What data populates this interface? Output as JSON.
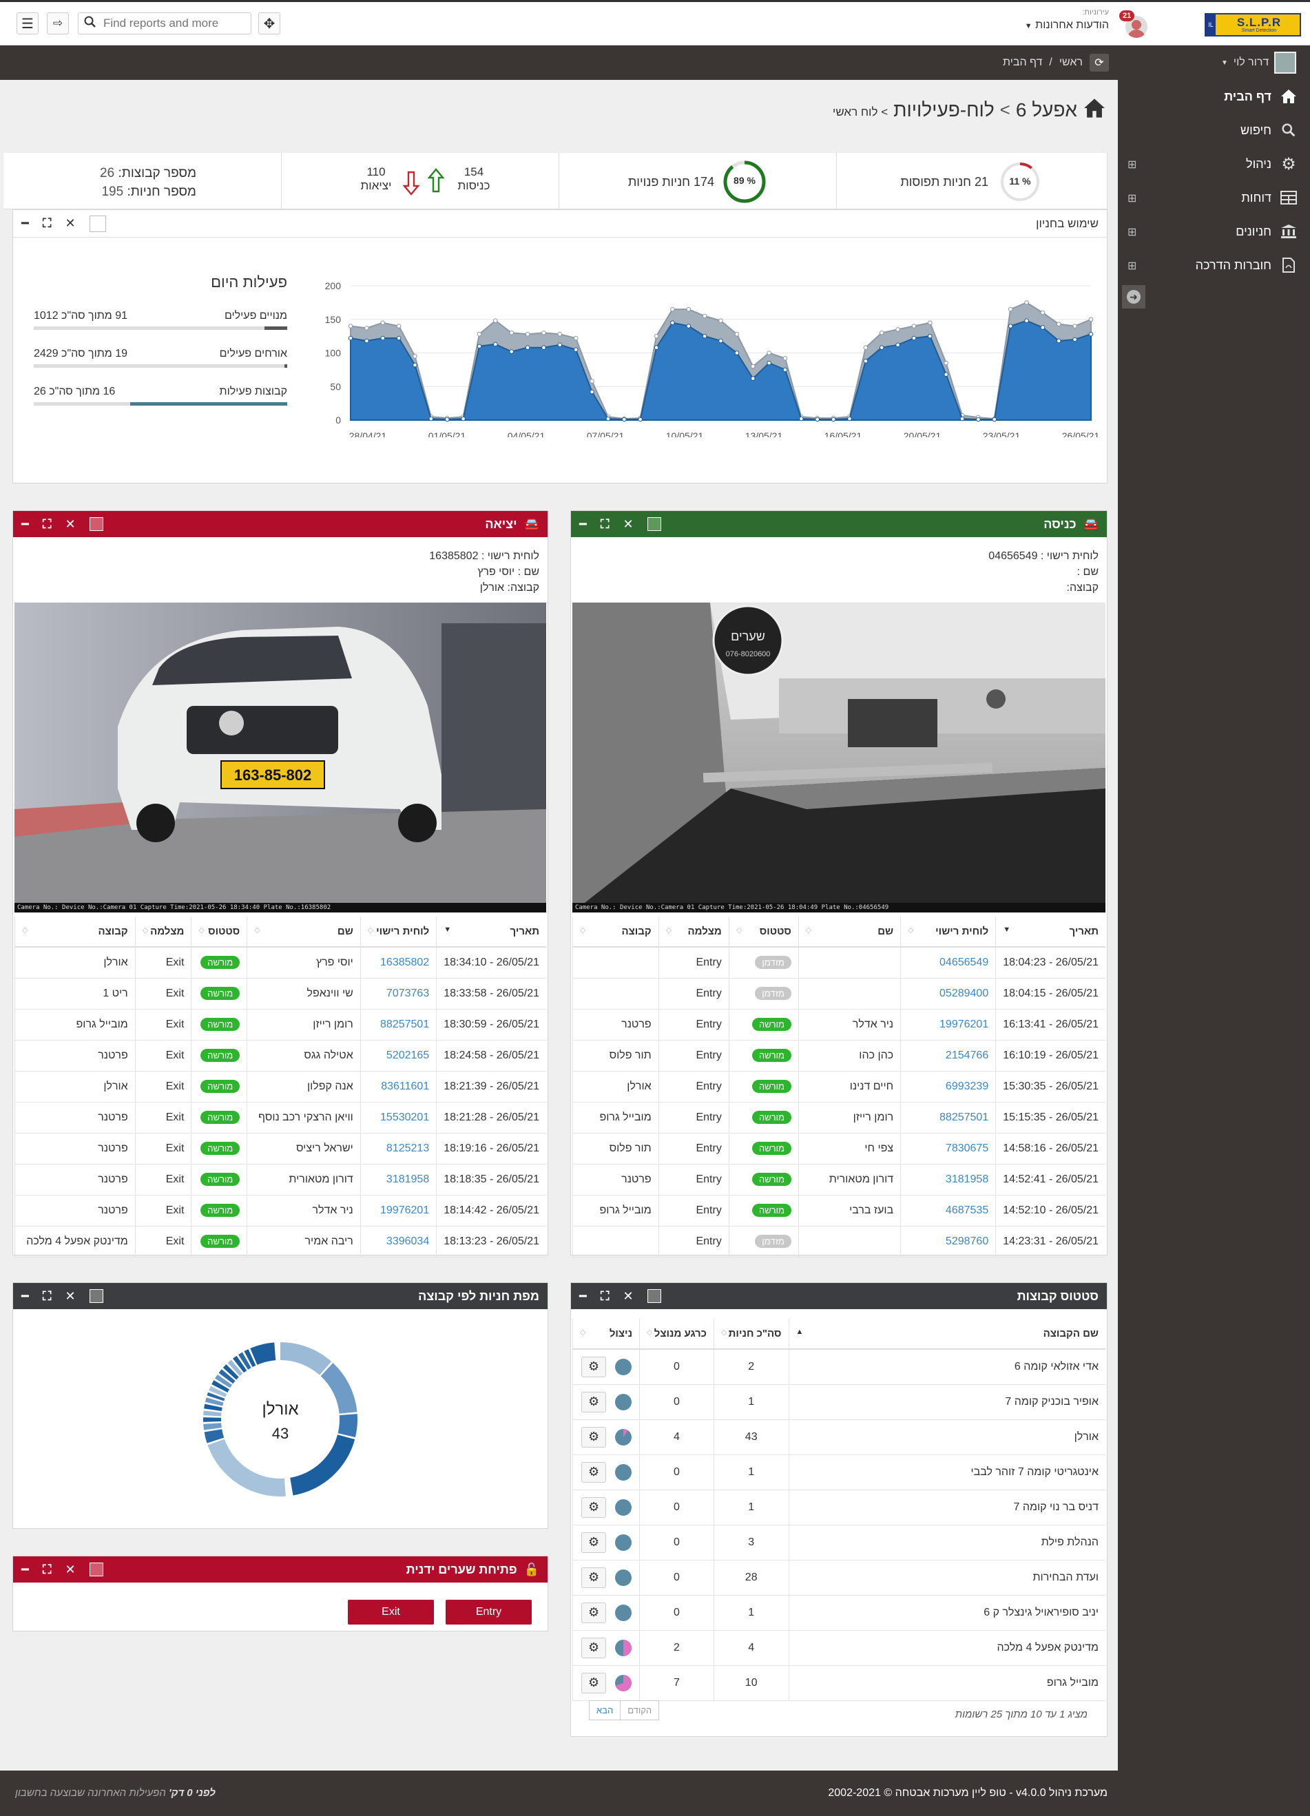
{
  "topbar": {
    "search_placeholder": "Find reports and more",
    "notifications_count": "21",
    "org_label": "עירוניות:",
    "recent_messages": "הודעות אחרונות",
    "logo_text": "S.L.P.R",
    "logo_sub": "Smart Detection"
  },
  "crumbbar": {
    "user": "דרור לוי",
    "home": "ראשי",
    "sep": "/",
    "current": "דף הבית"
  },
  "sidebar": {
    "items": [
      {
        "label": "דף הבית",
        "icon": "home-icon"
      },
      {
        "label": "חיפוש",
        "icon": "search-icon"
      },
      {
        "label": "ניהול",
        "icon": "gear-icon"
      },
      {
        "label": "דוחות",
        "icon": "table-icon"
      },
      {
        "label": "חניונים",
        "icon": "bank-icon"
      },
      {
        "label": "חוברות הדרכה",
        "icon": "pdf-icon"
      }
    ]
  },
  "page": {
    "title_main": "אפעל 6",
    "title_sep": ">",
    "title_sub": "לוח-פעילויות",
    "title_small": "> לוח ראשי"
  },
  "stats": {
    "occupied_pct": "11 %",
    "occupied_text": "21 חניות תפוסות",
    "free_pct": "89 %",
    "free_text": "174 חניות פנויות",
    "entries_value": "154",
    "entries_label": "כניסות",
    "exits_value": "110",
    "exits_label": "יציאות",
    "groups_label": "מספר קבוצות:",
    "groups_value": "26",
    "spaces_label": "מספר חניות:",
    "spaces_value": "195"
  },
  "usage_panel": {
    "title": "שימוש בחניון",
    "activity_title": "פעילות היום",
    "bars": [
      {
        "label": "מנויים פעילים",
        "text": "91 מתוך סה\"כ 1012",
        "fraction": 0.09
      },
      {
        "label": "אורחים פעילים",
        "text": "19 מתוך סה\"כ 2429",
        "fraction": 0.01
      },
      {
        "label": "קבוצות פעילות",
        "text": "16 מתוך סה\"כ 26",
        "fraction": 0.62
      }
    ]
  },
  "chart_data": {
    "type": "area",
    "title": "",
    "xlabel": "",
    "ylabel": "",
    "ylim": [
      0,
      200
    ],
    "yticks": [
      "0",
      "50",
      "100",
      "150",
      "200"
    ],
    "xtick_labels": [
      "28/04/21",
      "01/05/21",
      "04/05/21",
      "07/05/21",
      "10/05/21",
      "13/05/21",
      "16/05/21",
      "20/05/21",
      "23/05/21",
      "26/05/21"
    ],
    "colors": {
      "series_total": "#a3afbb",
      "series_subscribers": "#2f7ac2"
    },
    "series": [
      {
        "values": [
          140,
          137,
          145,
          140,
          95,
          5,
          3,
          5,
          128,
          148,
          130,
          128,
          130,
          128,
          122,
          58,
          5,
          2,
          3,
          125,
          165,
          165,
          155,
          148,
          128,
          80,
          100,
          92,
          5,
          3,
          3,
          5,
          108,
          130,
          135,
          140,
          145,
          85,
          7,
          4,
          2,
          165,
          175,
          160,
          143,
          140,
          150
        ]
      },
      {
        "values": [
          122,
          118,
          122,
          122,
          82,
          2,
          1,
          2,
          110,
          113,
          102,
          108,
          108,
          112,
          105,
          42,
          2,
          1,
          1,
          108,
          145,
          140,
          125,
          118,
          100,
          62,
          85,
          75,
          2,
          1,
          1,
          2,
          88,
          108,
          112,
          122,
          125,
          68,
          2,
          1,
          1,
          140,
          148,
          138,
          118,
          120,
          128
        ]
      }
    ]
  },
  "entry_panel": {
    "title": "כניסה",
    "plate_label": "לוחית רישוי : 04656549",
    "name_label": "שם :",
    "group_label": "קבוצה:",
    "camera_caption": "Camera No.: Device No.:Camera 01 Capture Time:2021-05-26 18:04:49  Plate No.:04656549",
    "sign_text": "שערים",
    "sign_phone": "076-8020600",
    "columns": [
      "תאריך",
      "לוחית רישוי",
      "שם",
      "סטטוס",
      "מצלמה",
      "קבוצה"
    ],
    "rows": [
      [
        "26/05/21 - 18:04:23",
        "04656549",
        "",
        "מזדמן",
        "Entry",
        ""
      ],
      [
        "26/05/21 - 18:04:15",
        "05289400",
        "",
        "מזדמן",
        "Entry",
        ""
      ],
      [
        "26/05/21 - 16:13:41",
        "19976201",
        "ניר אדלר",
        "מורשה",
        "Entry",
        "פרטנר"
      ],
      [
        "26/05/21 - 16:10:19",
        "2154766",
        "כהן כהו",
        "מורשה",
        "Entry",
        "תור פלוס"
      ],
      [
        "26/05/21 - 15:30:35",
        "6993239",
        "חיים דנינו",
        "מורשה",
        "Entry",
        "אורלן"
      ],
      [
        "26/05/21 - 15:15:35",
        "88257501",
        "רומן רייזן",
        "מורשה",
        "Entry",
        "מובייל גרופ"
      ],
      [
        "26/05/21 - 14:58:16",
        "7830675",
        "צפי חי",
        "מורשה",
        "Entry",
        "תור פלוס"
      ],
      [
        "26/05/21 - 14:52:41",
        "3181958",
        "דורון מטאורית",
        "מורשה",
        "Entry",
        "פרטנר"
      ],
      [
        "26/05/21 - 14:52:10",
        "4687535",
        "בועז ברבי",
        "מורשה",
        "Entry",
        "מובייל גרופ"
      ],
      [
        "26/05/21 - 14:23:31",
        "5298760",
        "",
        "מזדמן",
        "Entry",
        ""
      ]
    ]
  },
  "exit_panel": {
    "title": "יציאה",
    "plate_label": "לוחית רישוי : 16385802",
    "name_label": "שם : יוסי פרץ",
    "group_label": "קבוצה: אורלן",
    "camera_caption": "Camera No.: Device No.:Camera 01 Capture Time:2021-05-26 18:34:40  Plate No.:16385802",
    "car_plate": "163-85-802",
    "columns": [
      "תאריך",
      "לוחית רישוי",
      "שם",
      "סטטוס",
      "מצלמה",
      "קבוצה"
    ],
    "rows": [
      [
        "26/05/21 - 18:34:10",
        "16385802",
        "יוסי פרץ",
        "מורשה",
        "Exit",
        "אורלן"
      ],
      [
        "26/05/21 - 18:33:58",
        "7073763",
        "שי ווינאפל",
        "מורשה",
        "Exit",
        "ריט 1"
      ],
      [
        "26/05/21 - 18:30:59",
        "88257501",
        "רומן רייזן",
        "מורשה",
        "Exit",
        "מובייל גרופ"
      ],
      [
        "26/05/21 - 18:24:58",
        "5202165",
        "אטילה גגס",
        "מורשה",
        "Exit",
        "פרטנר"
      ],
      [
        "26/05/21 - 18:21:39",
        "83611601",
        "אנה קפלון",
        "מורשה",
        "Exit",
        "אורלן"
      ],
      [
        "26/05/21 - 18:21:28",
        "15530201",
        "וויאן הרצקי רכב נוסף",
        "מורשה",
        "Exit",
        "פרטנר"
      ],
      [
        "26/05/21 - 18:19:16",
        "8125213",
        "ישראל ריציס",
        "מורשה",
        "Exit",
        "פרטנר"
      ],
      [
        "26/05/21 - 18:18:35",
        "3181958",
        "דורון מטאורית",
        "מורשה",
        "Exit",
        "פרטנר"
      ],
      [
        "26/05/21 - 18:14:42",
        "19976201",
        "ניר אדלר",
        "מורשה",
        "Exit",
        "פרטנר"
      ],
      [
        "26/05/21 - 18:13:23",
        "3396034",
        "ריבה אמיר",
        "מורשה",
        "Exit",
        "מדינטק אפעל 4 מלכה"
      ]
    ]
  },
  "groups_panel": {
    "title": "סטטוס קבוצות",
    "columns": [
      "שם הקבוצה",
      "סה\"כ חניות",
      "כרגע מנוצל",
      "ניצול"
    ],
    "rows": [
      {
        "name": "אדי אזולאי קומה 6",
        "total": "2",
        "used": "0",
        "usage": 0
      },
      {
        "name": "אופיר בוכניק קומה 7",
        "total": "1",
        "used": "0",
        "usage": 0
      },
      {
        "name": "אורלן",
        "total": "43",
        "used": "4",
        "usage": 0.09
      },
      {
        "name": "אינטגריטי קומה 7 זוהר לבבי",
        "total": "1",
        "used": "0",
        "usage": 0
      },
      {
        "name": "דניס בר נוי קומה 7",
        "total": "1",
        "used": "0",
        "usage": 0
      },
      {
        "name": "הנהלת פילת",
        "total": "3",
        "used": "0",
        "usage": 0
      },
      {
        "name": "ועדת הבחירות",
        "total": "28",
        "used": "0",
        "usage": 0
      },
      {
        "name": "יניב סופיראויל גינצלר ק 6",
        "total": "1",
        "used": "0",
        "usage": 0
      },
      {
        "name": "מדינטק אפעל 4 מלכה",
        "total": "4",
        "used": "2",
        "usage": 0.5
      },
      {
        "name": "מובייל גרופ",
        "total": "10",
        "used": "7",
        "usage": 0.7
      }
    ],
    "summary": "מציג 1 עד 10 מתוך 25 רשומות",
    "next": "הבא",
    "prev": "הקודם"
  },
  "map_panel": {
    "title": "מפת חניות לפי קבוצה",
    "center_name": "אורלן",
    "center_value": "43"
  },
  "gates_panel": {
    "title": "פתיחת שערים ידנית",
    "exit_btn": "Exit",
    "entry_btn": "Entry"
  },
  "footer": {
    "left": "הפעילות האחרונה שבוצעה בחשבון",
    "left_bold": "לפני 0 דק'",
    "right": "מערכת ניהול v4.0.0 - טופ ליין מערכות אבטחה © 2002-2021"
  }
}
